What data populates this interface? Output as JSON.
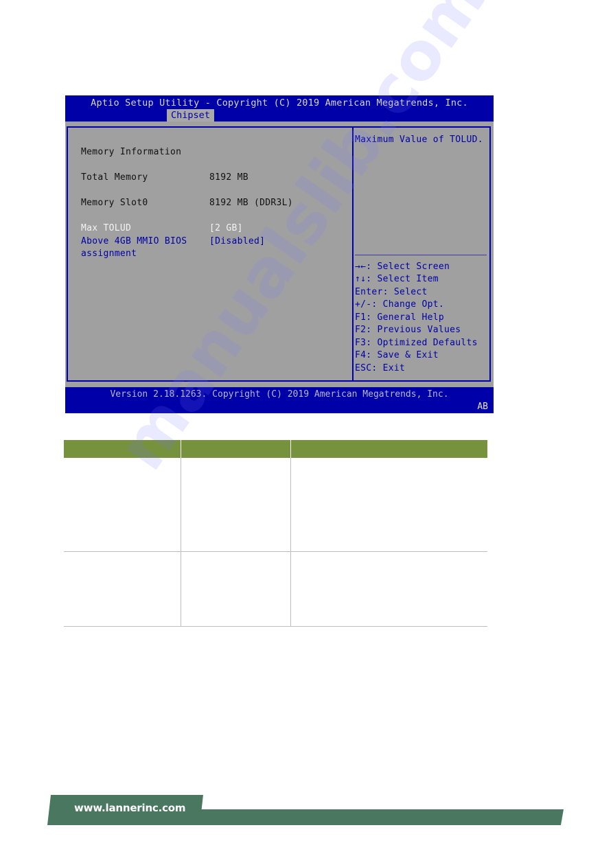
{
  "bios": {
    "title": "Aptio Setup Utility - Copyright (C) 2019 American Megatrends, Inc.",
    "active_tab": "Chipset",
    "settings": [
      {
        "label": "Memory Information",
        "value": "",
        "style": "info"
      },
      {
        "label": "Total Memory",
        "value": "8192 MB",
        "style": "info"
      },
      {
        "label": "Memory Slot0",
        "value": "8192 MB (DDR3L)",
        "style": "info"
      },
      {
        "label": "Max TOLUD",
        "value": "[2 GB]",
        "style": "selected"
      },
      {
        "label": "Above 4GB MMIO BIOS",
        "label_line2": "assignment",
        "value": "[Disabled]",
        "style": "option"
      }
    ],
    "help_text": "Maximum Value of TOLUD.",
    "key_help": [
      {
        "key": "→←",
        "desc": ": Select Screen",
        "icon": "arrows-left-right-icon"
      },
      {
        "key": "↑↓",
        "desc": ": Select Item",
        "icon": "arrows-up-down-icon"
      },
      {
        "key": "Enter",
        "desc": ": Select"
      },
      {
        "key": "+/-",
        "desc": ": Change Opt."
      },
      {
        "key": "F1",
        "desc": ": General Help"
      },
      {
        "key": "F2",
        "desc": ": Previous Values"
      },
      {
        "key": "F3",
        "desc": ": Optimized Defaults"
      },
      {
        "key": "F4",
        "desc": ": Save & Exit"
      },
      {
        "key": "ESC",
        "desc": ": Exit"
      }
    ],
    "version": "Version 2.18.1263. Copyright (C) 2019 American Megatrends, Inc.",
    "corner_code": "AB"
  },
  "table": {
    "headers": [
      "",
      "",
      ""
    ],
    "rows": [
      [
        "",
        "",
        ""
      ],
      [
        "",
        "",
        ""
      ]
    ]
  },
  "footer": {
    "url": "www.lannerinc.com"
  },
  "watermark": "manualslib.com",
  "colors": {
    "bios_blue": "#0000a8",
    "bios_grey": "#a0a0a0",
    "table_header": "#76923c",
    "banner_green": "#4a7760"
  }
}
